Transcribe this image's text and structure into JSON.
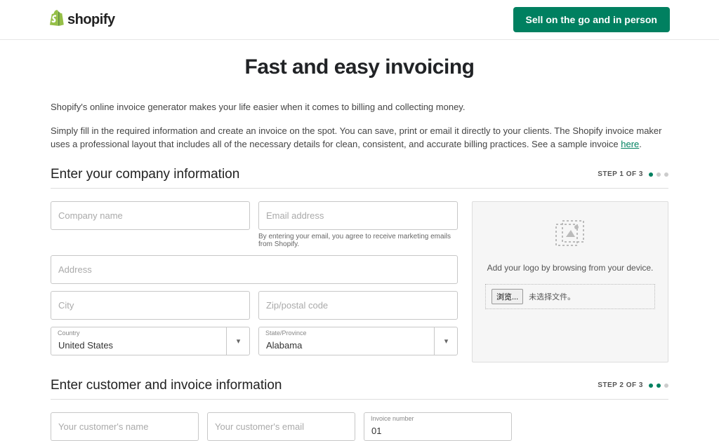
{
  "header": {
    "brand": "shopify",
    "cta": "Sell on the go and in person"
  },
  "page": {
    "title": "Fast and easy invoicing",
    "intro1": "Shopify's online invoice generator makes your life easier when it comes to billing and collecting money.",
    "intro2_a": "Simply fill in the required information and create an invoice on the spot. You can save, print or email it directly to your clients. The Shopify invoice maker uses a professional layout that includes all of the necessary details for clean, consistent, and accurate billing practices. See a sample invoice ",
    "intro2_link": "here",
    "intro2_b": "."
  },
  "section1": {
    "title": "Enter your company information",
    "step": "STEP 1 OF 3",
    "company_name_ph": "Company name",
    "email_ph": "Email address",
    "email_helper": "By entering your email, you agree to receive marketing emails from Shopify.",
    "address_ph": "Address",
    "city_ph": "City",
    "zip_ph": "Zip/postal code",
    "country_label": "Country",
    "country_value": "United States",
    "state_label": "State/Province",
    "state_value": "Alabama",
    "logo_hint": "Add your logo by browsing from your device.",
    "browse_btn": "浏览...",
    "no_file": "未选择文件。"
  },
  "section2": {
    "title": "Enter customer and invoice information",
    "step": "STEP 2 OF 3",
    "customer_name_ph": "Your customer's name",
    "customer_email_ph": "Your customer's email",
    "invoice_label": "Invoice number",
    "invoice_value": "01"
  }
}
